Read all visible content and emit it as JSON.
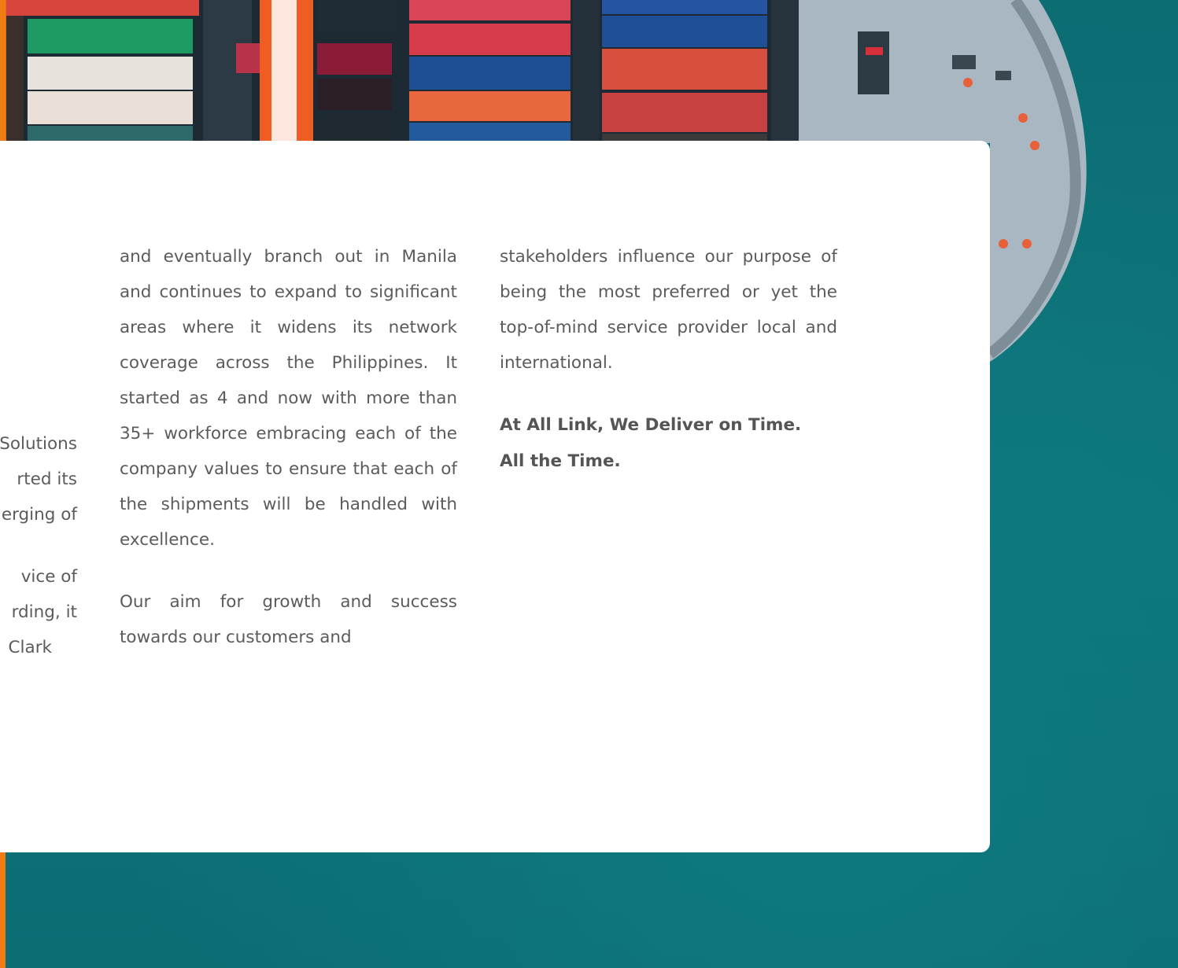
{
  "content": {
    "left_col_fragments": [
      "Solutions",
      "rted its",
      "erging of",
      "vice of",
      "rding, it",
      "Clark"
    ],
    "col1_para1": "and eventually branch out in Manila and continues to expand to significant areas where it widens its network coverage across the Philippines. It started as 4 and now with more than 35+ workforce embracing each of the company values to ensure that each of the shipments will be handled with excellence.",
    "col1_para2": "Our aim for growth and success towards our customers and",
    "col2_para1": "stakeholders influence our purpose of being the most preferred or yet the top-of-mind service provider local and international.",
    "tagline_line1": "At All Link, We Deliver on Time.",
    "tagline_line2": "All the Time."
  },
  "colors": {
    "accent": "#ef7b12",
    "sea": "#0d7278",
    "card": "#ffffff",
    "body_text": "#5b5b5b"
  }
}
